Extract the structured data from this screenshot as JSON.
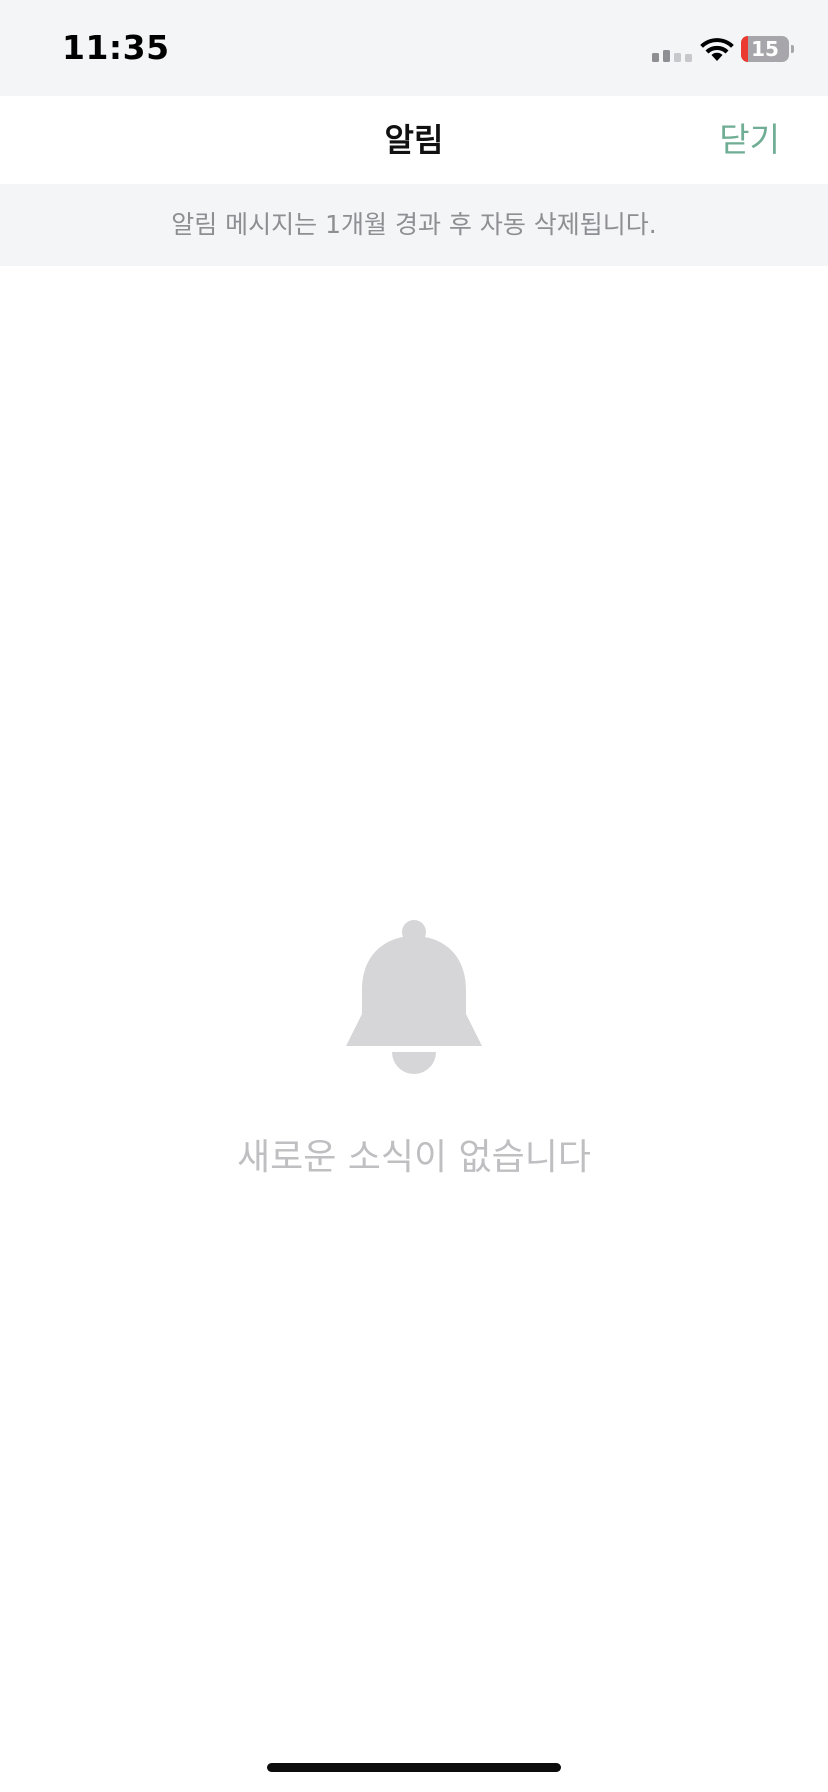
{
  "status_bar": {
    "time": "11:35",
    "battery_level": "15",
    "battery_fraction": 0.15,
    "signal_icon": "cellular-signal-icon",
    "wifi_icon": "wifi-icon"
  },
  "header": {
    "title": "알림",
    "close_label": "닫기"
  },
  "notice": {
    "text": "알림 메시지는 1개월 경과 후 자동 삭제됩니다."
  },
  "empty_state": {
    "icon": "bell-icon",
    "message": "새로운 소식이 없습니다"
  },
  "colors": {
    "accent": "#6fad94",
    "banner_bg": "#f4f5f7",
    "empty_text": "#bfbfc2",
    "bell": "#d6d6d8",
    "battery_low": "#eb3b30"
  }
}
